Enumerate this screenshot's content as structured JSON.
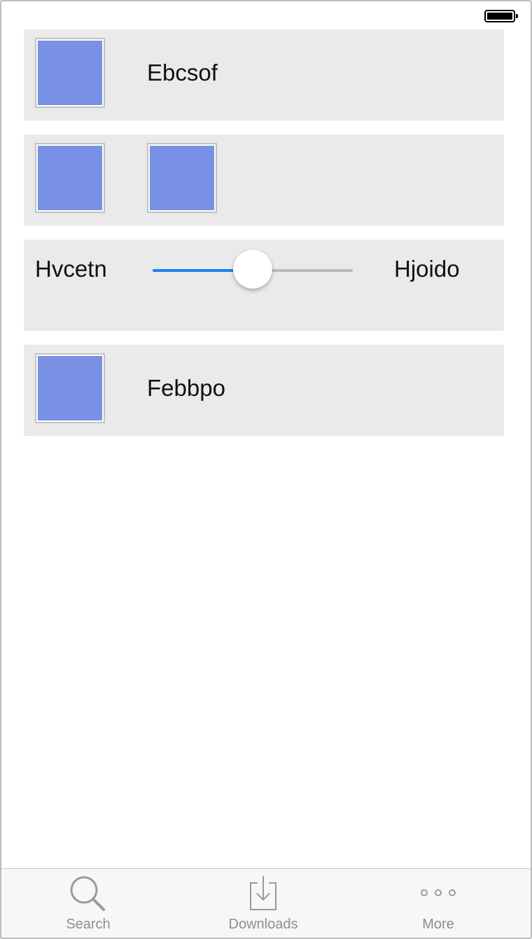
{
  "status_bar": {
    "battery_icon": "battery-full-icon"
  },
  "cards": [
    {
      "label": "Ebcsof"
    },
    {
      "label": ""
    },
    {
      "left_label": "Hvcetn",
      "right_label": "Hjoido",
      "slider_value": 0.5
    },
    {
      "label": "Febbpo"
    }
  ],
  "tabbar": {
    "items": [
      {
        "label": "Search",
        "icon": "search-icon"
      },
      {
        "label": "Downloads",
        "icon": "downloads-icon"
      },
      {
        "label": "More",
        "icon": "more-icon"
      }
    ]
  },
  "colors": {
    "card_bg": "#eaeaea",
    "thumb_fill": "#7891e4",
    "slider_active": "#1f7ff1",
    "slider_track": "#b9b9b9",
    "tab_label": "#8e8e8e"
  }
}
